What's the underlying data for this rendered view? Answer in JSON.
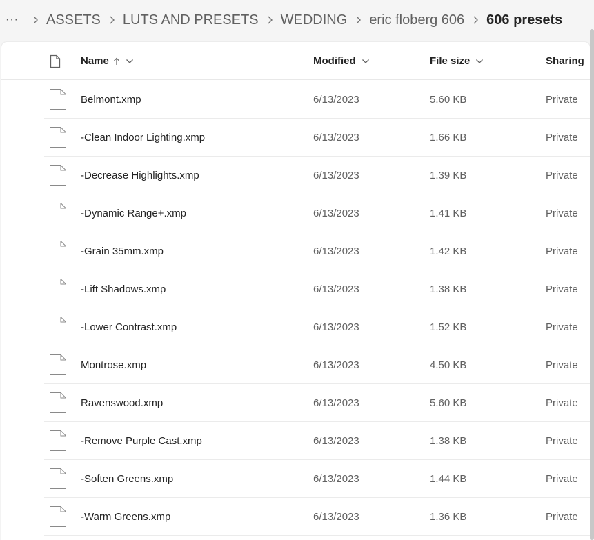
{
  "breadcrumb": {
    "more": "···",
    "items": [
      "ASSETS",
      "LUTS AND PRESETS",
      "WEDDING",
      "eric floberg 606"
    ],
    "current": "606 presets"
  },
  "columns": {
    "name": "Name",
    "modified": "Modified",
    "size": "File size",
    "sharing": "Sharing"
  },
  "icons": {
    "header_file": "document-icon",
    "row_file": "file-icon",
    "sort": "arrow-up-icon",
    "menu": "chevron-down-icon"
  },
  "files": [
    {
      "name": "Belmont.xmp",
      "modified": "6/13/2023",
      "size": "5.60 KB",
      "sharing": "Private"
    },
    {
      "name": "-Clean Indoor Lighting.xmp",
      "modified": "6/13/2023",
      "size": "1.66 KB",
      "sharing": "Private"
    },
    {
      "name": "-Decrease Highlights.xmp",
      "modified": "6/13/2023",
      "size": "1.39 KB",
      "sharing": "Private"
    },
    {
      "name": "-Dynamic Range+.xmp",
      "modified": "6/13/2023",
      "size": "1.41 KB",
      "sharing": "Private"
    },
    {
      "name": "-Grain 35mm.xmp",
      "modified": "6/13/2023",
      "size": "1.42 KB",
      "sharing": "Private"
    },
    {
      "name": "-Lift Shadows.xmp",
      "modified": "6/13/2023",
      "size": "1.38 KB",
      "sharing": "Private"
    },
    {
      "name": "-Lower Contrast.xmp",
      "modified": "6/13/2023",
      "size": "1.52 KB",
      "sharing": "Private"
    },
    {
      "name": "Montrose.xmp",
      "modified": "6/13/2023",
      "size": "4.50 KB",
      "sharing": "Private"
    },
    {
      "name": "Ravenswood.xmp",
      "modified": "6/13/2023",
      "size": "5.60 KB",
      "sharing": "Private"
    },
    {
      "name": "-Remove Purple Cast.xmp",
      "modified": "6/13/2023",
      "size": "1.38 KB",
      "sharing": "Private"
    },
    {
      "name": "-Soften Greens.xmp",
      "modified": "6/13/2023",
      "size": "1.44 KB",
      "sharing": "Private"
    },
    {
      "name": "-Warm Greens.xmp",
      "modified": "6/13/2023",
      "size": "1.36 KB",
      "sharing": "Private"
    }
  ],
  "colors": {
    "background": "#f5f5f5",
    "panel": "#ffffff",
    "text": "#242424",
    "muted_text": "#616161",
    "divider": "#ebebeb"
  }
}
